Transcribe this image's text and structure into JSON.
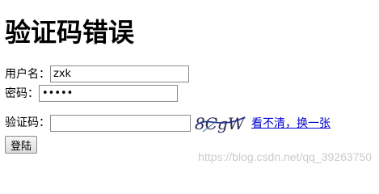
{
  "page": {
    "heading": "验证码错误"
  },
  "form": {
    "username_label": "用户名：",
    "username_value": "zxk",
    "password_label": "密码：",
    "password_value": "•••••",
    "captcha_label": "验证码：",
    "captcha_value": "",
    "captcha_image_text": "8CgW",
    "refresh_link": "看不清，换一张",
    "submit_label": "登陆"
  },
  "watermark": "https://blog.csdn.net/qq_39263750"
}
